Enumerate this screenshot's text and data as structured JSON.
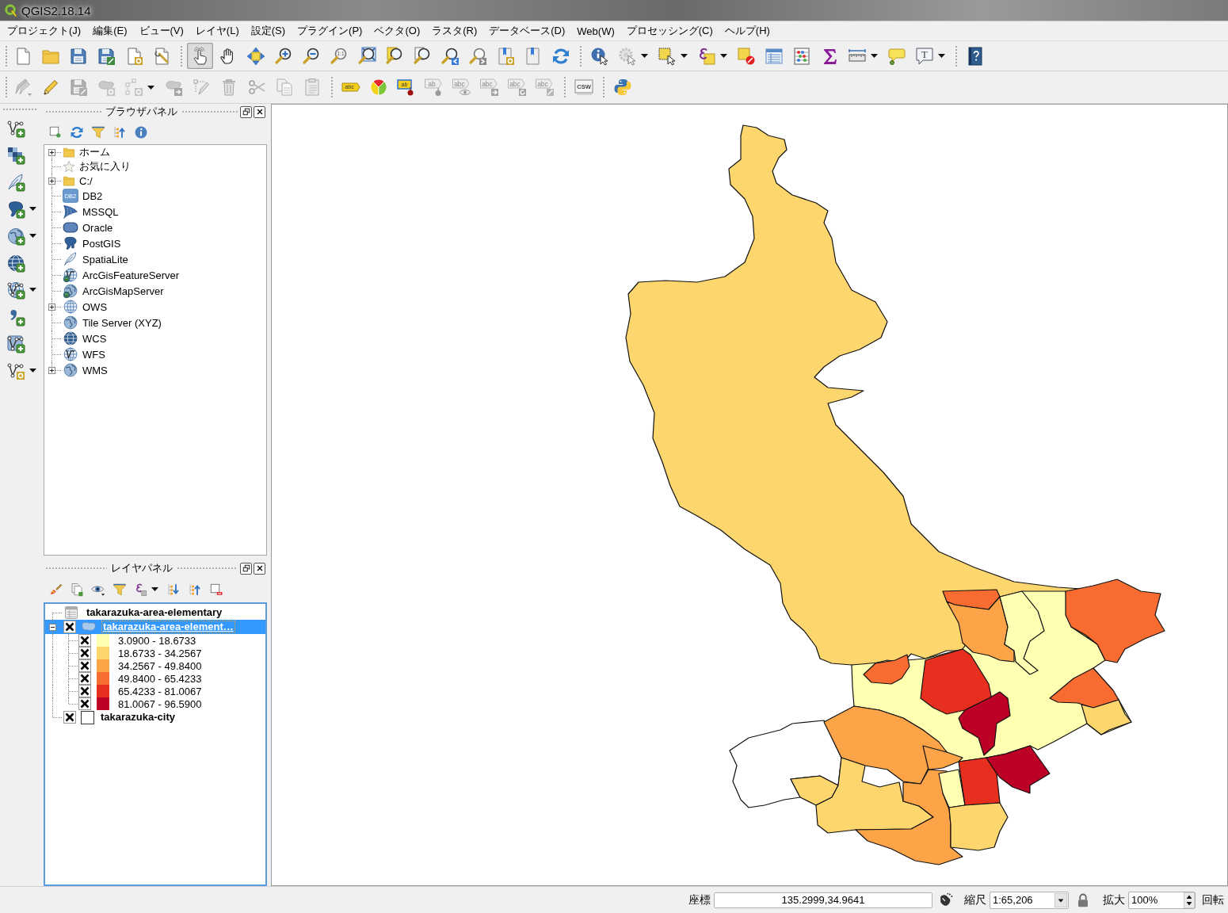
{
  "window": {
    "title": "QGIS2.18.14"
  },
  "menu_bar": [
    "プロジェクト(J)",
    "編集(E)",
    "ビュー(V)",
    "レイヤ(L)",
    "設定(S)",
    "プラグイン(P)",
    "ベクタ(O)",
    "ラスタ(R)",
    "データベース(D)",
    "Web(W)",
    "プロセッシング(C)",
    "ヘルプ(H)"
  ],
  "toolbars": [
    {
      "groups": [
        {
          "buttons": [
            {
              "selected": false,
              "disabled": false
            },
            {
              "selected": false,
              "disabled": false
            },
            {
              "selected": false,
              "disabled": false
            },
            {
              "selected": false,
              "disabled": false
            },
            {
              "selected": false,
              "disabled": false
            },
            {
              "selected": false,
              "disabled": false
            }
          ]
        },
        {
          "buttons": [
            {
              "selected": true,
              "disabled": false
            },
            {
              "selected": false,
              "disabled": false
            },
            {
              "selected": false,
              "disabled": false
            },
            {
              "selected": false,
              "disabled": false
            },
            {
              "selected": false,
              "disabled": false
            },
            {
              "selected": false,
              "disabled": false,
              "icon_text": "1:1"
            },
            {
              "selected": false,
              "disabled": false
            },
            {
              "selected": false,
              "disabled": false
            },
            {
              "selected": false,
              "disabled": false
            },
            {
              "selected": false,
              "disabled": false
            },
            {
              "selected": false,
              "disabled": false
            },
            {
              "selected": false,
              "disabled": false
            },
            {
              "selected": false,
              "disabled": false
            },
            {
              "selected": false,
              "disabled": false
            }
          ]
        },
        {
          "buttons": [
            {
              "selected": false,
              "disabled": false
            },
            {
              "selected": false,
              "disabled": true
            },
            {
              "selected": false,
              "disabled": false
            },
            {
              "selected": false,
              "disabled": false
            },
            {
              "selected": false,
              "disabled": false
            },
            {
              "selected": false,
              "disabled": false
            },
            {
              "selected": false,
              "disabled": false
            },
            {
              "selected": false,
              "disabled": false
            },
            {
              "selected": false,
              "disabled": false
            },
            {
              "selected": false,
              "disabled": false
            },
            {
              "selected": false,
              "disabled": false,
              "icon_text": "T"
            }
          ]
        },
        {
          "buttons": [
            {
              "selected": false,
              "disabled": false
            }
          ]
        }
      ]
    },
    {
      "groups": [
        {
          "buttons": [
            {
              "selected": false,
              "disabled": true
            },
            {
              "selected": false,
              "disabled": false
            },
            {
              "selected": false,
              "disabled": true
            },
            {
              "selected": false,
              "disabled": true
            },
            {
              "selected": false,
              "disabled": true
            },
            {
              "selected": false,
              "disabled": true
            },
            {
              "selected": false,
              "disabled": true
            },
            {
              "selected": false,
              "disabled": true
            },
            {
              "selected": false,
              "disabled": true
            },
            {
              "selected": false,
              "disabled": true
            },
            {
              "selected": false,
              "disabled": true
            }
          ]
        },
        {
          "buttons": [
            {
              "selected": false,
              "disabled": false,
              "icon_text": "abc"
            },
            {
              "selected": false,
              "disabled": false
            },
            {
              "selected": false,
              "disabled": false,
              "icon_text": "ab"
            },
            {
              "selected": false,
              "disabled": true,
              "icon_text": "ab"
            },
            {
              "selected": false,
              "disabled": true,
              "icon_text": "abc"
            },
            {
              "selected": false,
              "disabled": true,
              "icon_text": "abc"
            },
            {
              "selected": false,
              "disabled": true,
              "icon_text": "abc"
            },
            {
              "selected": false,
              "disabled": true,
              "icon_text": "abc"
            }
          ]
        },
        {
          "buttons": [
            {
              "selected": false,
              "disabled": false,
              "icon_text": "CSW"
            }
          ]
        },
        {
          "buttons": [
            {
              "selected": false,
              "disabled": false
            }
          ]
        }
      ]
    }
  ],
  "browser_panel": {
    "title": "ブラウザパネル",
    "items": [
      {
        "label": "ホーム",
        "expandable": true
      },
      {
        "label": "お気に入り",
        "expandable": false
      },
      {
        "label": "C:/",
        "expandable": true
      },
      {
        "label": "DB2",
        "expandable": false,
        "icon_text": "DB2"
      },
      {
        "label": "MSSQL",
        "expandable": false
      },
      {
        "label": "Oracle",
        "expandable": false
      },
      {
        "label": "PostGIS",
        "expandable": false
      },
      {
        "label": "SpatiaLite",
        "expandable": false
      },
      {
        "label": "ArcGisFeatureServer",
        "expandable": false
      },
      {
        "label": "ArcGisMapServer",
        "expandable": false
      },
      {
        "label": "OWS",
        "expandable": true
      },
      {
        "label": "Tile Server (XYZ)",
        "expandable": false
      },
      {
        "label": "WCS",
        "expandable": false
      },
      {
        "label": "WFS",
        "expandable": false
      },
      {
        "label": "WMS",
        "expandable": true
      }
    ]
  },
  "layers_panel": {
    "title": "レイヤパネル",
    "layers": [
      {
        "kind": "table",
        "label": "takarazuka-area-elementary",
        "selected": false
      },
      {
        "kind": "graduated",
        "label": "takarazuka-area-element…",
        "checked": true,
        "expanded": true,
        "selected": true,
        "children": [
          {
            "label": "3.0900 - 18.6733",
            "checked": true,
            "color": "#ffffb2"
          },
          {
            "label": "18.6733 - 34.2567",
            "checked": true,
            "color": "#fed66e"
          },
          {
            "label": "34.2567 - 49.8400",
            "checked": true,
            "color": "#fda449"
          },
          {
            "label": "49.8400 - 65.4233",
            "checked": true,
            "color": "#f86c31"
          },
          {
            "label": "65.4233 - 81.0067",
            "checked": true,
            "color": "#e62f1f"
          },
          {
            "label": "81.0067 - 96.5900",
            "checked": true,
            "color": "#bd0026"
          }
        ]
      },
      {
        "kind": "single",
        "label": "takarazuka-city",
        "checked": true,
        "selected": false
      }
    ]
  },
  "status_bar": {
    "coordinate_label": "座標",
    "coordinate": "135.2999,34.9641",
    "scale_label": "縮尺",
    "scale": "1:65,206",
    "magnifier_label": "拡大",
    "magnifier": "100%",
    "rotation_label": "回転"
  }
}
